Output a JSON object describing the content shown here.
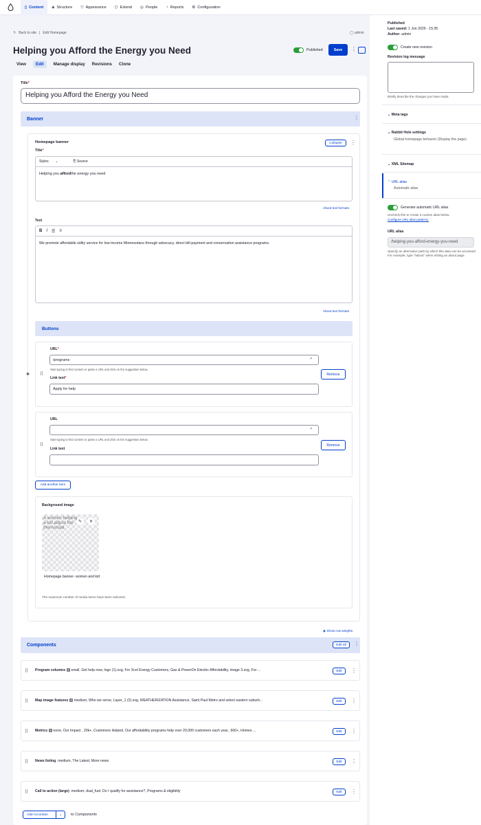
{
  "toolbar": {
    "items": [
      {
        "label": "Content"
      },
      {
        "label": "Structure"
      },
      {
        "label": "Appearance"
      },
      {
        "label": "Extend"
      },
      {
        "label": "People"
      },
      {
        "label": "Reports"
      },
      {
        "label": "Configuration"
      }
    ]
  },
  "header": {
    "back": "Back to site",
    "crumb": "Edit Homepage",
    "user": "admin",
    "title": "Helping you Afford the Energy you Need",
    "published": "Published",
    "save": "Save"
  },
  "tabs": [
    "View",
    "Edit",
    "Manage display",
    "Revisions",
    "Clone"
  ],
  "form": {
    "title_label": "Title",
    "title_value": "Helping you Afford the Energy you Need",
    "banner_heading": "Banner",
    "hb_title": "Homepage banner",
    "collapse": "Collapse",
    "hb_title_label": "Title",
    "styles": "Styles",
    "source": "Source",
    "hb_title_pre": "Helping you ",
    "hb_title_bold": "afford",
    "hb_title_post": "the energy you need",
    "about_formats": "About text formats",
    "text_label": "Text",
    "text_value": "We promote affordable utility service for low-income Minnesotans through advocacy, direct bill-payment and conservation assistance programs.",
    "buttons_heading": "Buttons",
    "url_label": "URL",
    "url1": "/programs",
    "url_help": "Start typing to find content or paste a URL and click on the suggestion below.",
    "link_text_label": "Link text",
    "link1": "Apply for help",
    "remove": "Remove",
    "add_item": "Add another item",
    "bg_label": "Background image",
    "media_alt": "A women helping a kid adjust the thermostat",
    "media_name": "Homepage banner- women and kid",
    "media_help": "The maximum number of media items have been selected.",
    "row_weights": "Show row weights",
    "components_heading": "Components",
    "edit_all": "Edit all",
    "edit": "Edit",
    "components": [
      {
        "name": "Program columns",
        "num": "2",
        "desc": "small, Get help now, logo (1).svg, For Xcel Energy Customers, Gas & PowerOn Electric Affordability, image 3.svg, For ..."
      },
      {
        "name": "Map image features",
        "num": "3",
        "desc": "medium, Who we serve, Layer_1 (2).svg, WEATHERIZATION Assistance, Saint Paul Metro and select eastern suburb..."
      },
      {
        "name": "Metrics",
        "num": "3",
        "desc": "none, Our Impact , 20k+, Customers Helped, Our affordability programs help over 20,000 customers each year., 600+, Homes ..."
      },
      {
        "name": "News listing",
        "num": "",
        "desc": "medium, The Latest, More news"
      },
      {
        "name": "Call to action (large)",
        "num": "",
        "desc": "medium, dual_fuel, Do I qualify for assistance?, Programs & eligibility"
      }
    ],
    "add_accordion": "Add Accordion",
    "to": "to",
    "to_target": "Components"
  },
  "sidebar": {
    "published": "Published",
    "last_saved_label": "Last saved:",
    "last_saved": "1 Jun 2026 - 15:35",
    "author_label": "Author:",
    "author": "admin",
    "new_revision": "Create new revision",
    "rev_log": "Revision log message",
    "rev_help": "Briefly describe the changes you have made.",
    "meta": "Meta tags",
    "rabbit": "Rabbit Hole settings",
    "rabbit_desc": "Global homepage behavior (Display the page)",
    "xml": "XML Sitemap",
    "url_alias": "URL alias",
    "url_alias_desc": "Automatic alias",
    "gen_alias": "Generate automatic URL alias",
    "gen_help": "Uncheck this to create a custom alias below.",
    "gen_link": "Configure URL alias patterns.",
    "alias_label": "URL alias",
    "alias_value": "/helping-you-afford-energy-you-need",
    "alias_help": "Specify an alternative path by which this data can be accessed. For example, type \"/about\" when writing an about page."
  }
}
